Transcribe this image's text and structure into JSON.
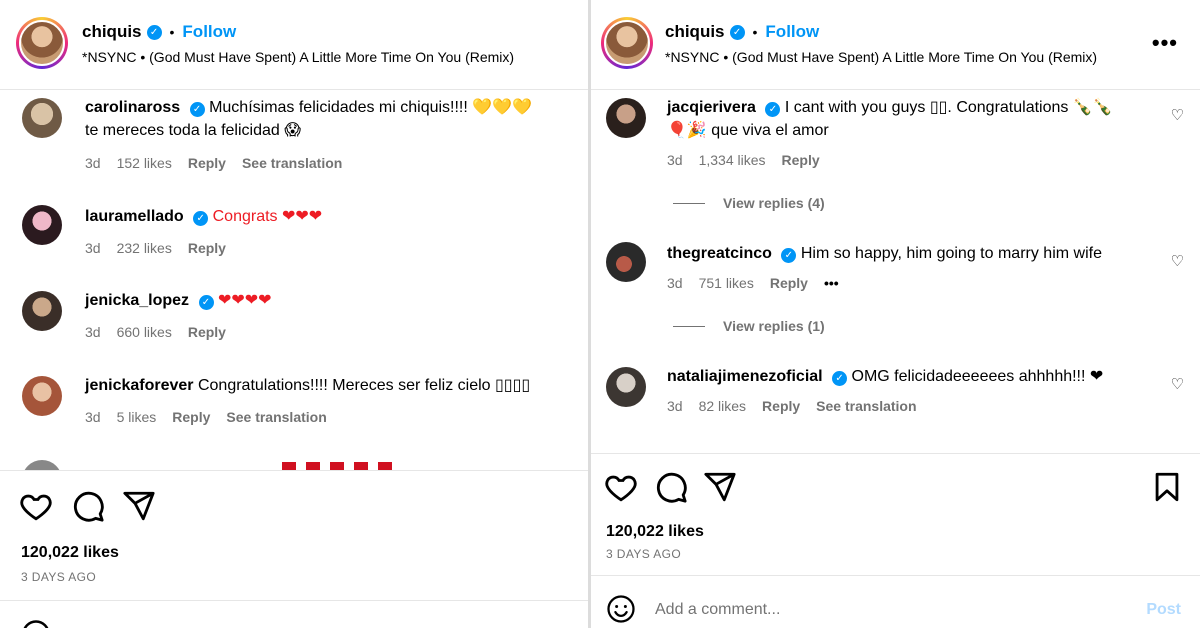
{
  "post": {
    "username": "chiquis",
    "verified_mark": "✓",
    "dot": "•",
    "follow_label": "Follow",
    "song": "*NSYNC • (God Must Have Spent) A Little More Time On You (Remix)",
    "likes": "120,022 likes",
    "time_ago": "3 DAYS AGO",
    "add_comment_placeholder": "Add a comment...",
    "post_label": "Post",
    "more_label": "•••"
  },
  "left_comments": [
    {
      "user": "carolinaross",
      "text": "Muchísimas felicidades mi chiquis!!!! 💛💛💛",
      "text2": "te mereces toda la felicidad 😱",
      "age": "3d",
      "likes": "152 likes",
      "reply": "Reply",
      "see": "See translation"
    },
    {
      "user": "lauramellado",
      "text": "Congrats ❤❤❤",
      "age": "3d",
      "likes": "232 likes",
      "reply": "Reply"
    },
    {
      "user": "jenicka_lopez",
      "text": "❤❤❤❤",
      "age": "3d",
      "likes": "660 likes",
      "reply": "Reply"
    },
    {
      "user": "jenickaforever",
      "text": "Congratulations!!!! Mereces ser feliz cielo ▯▯▯▯",
      "age": "3d",
      "likes": "5 likes",
      "reply": "Reply",
      "see": "See translation"
    }
  ],
  "right_comments": [
    {
      "user": "jacqierivera",
      "text": "I cant with you guys ▯▯. Congratulations 🍾🍾",
      "text2": "🎈🎉 que viva el amor",
      "age": "3d",
      "likes": "1,334 likes",
      "reply": "Reply",
      "view_replies": "View replies (4)"
    },
    {
      "user": "thegreatcinco",
      "text": "Him so happy, him going to marry him wife",
      "age": "3d",
      "likes": "751 likes",
      "reply": "Reply",
      "more": "•••",
      "view_replies": "View replies (1)"
    },
    {
      "user": "nataliajimenezoficial",
      "text": "OMG felicidadeeeeees ahhhhh!!! ❤",
      "age": "3d",
      "likes": "82 likes",
      "reply": "Reply",
      "see": "See translation"
    }
  ],
  "colors": {
    "accent": "#0095f6",
    "muted": "#737373",
    "heart": "#ed1c24",
    "post_disabled": "#b3dbff"
  },
  "icons": [
    "heart-icon",
    "comment-icon",
    "share-icon",
    "bookmark-icon",
    "emoji-icon",
    "verified-icon"
  ]
}
